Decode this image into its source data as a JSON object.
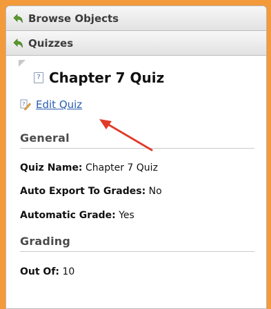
{
  "nav": {
    "browse_objects": "Browse Objects",
    "quizzes": "Quizzes"
  },
  "page": {
    "title": "Chapter 7 Quiz",
    "edit_link": "Edit Quiz"
  },
  "general": {
    "heading": "General",
    "quiz_name_label": "Quiz Name:",
    "quiz_name_value": "Chapter 7 Quiz",
    "auto_export_label": "Auto Export To Grades:",
    "auto_export_value": "No",
    "automatic_grade_label": "Automatic Grade:",
    "automatic_grade_value": "Yes"
  },
  "grading": {
    "heading": "Grading",
    "out_of_label": "Out Of:",
    "out_of_value": "10"
  },
  "colors": {
    "page_border": "#f39a3a",
    "back_icon": "#5a9a2c",
    "link": "#2a5db0",
    "annotation_arrow": "#e23a2a"
  },
  "icons": [
    "back-arrow-icon",
    "quiz-document-icon",
    "edit-pencil-icon"
  ]
}
